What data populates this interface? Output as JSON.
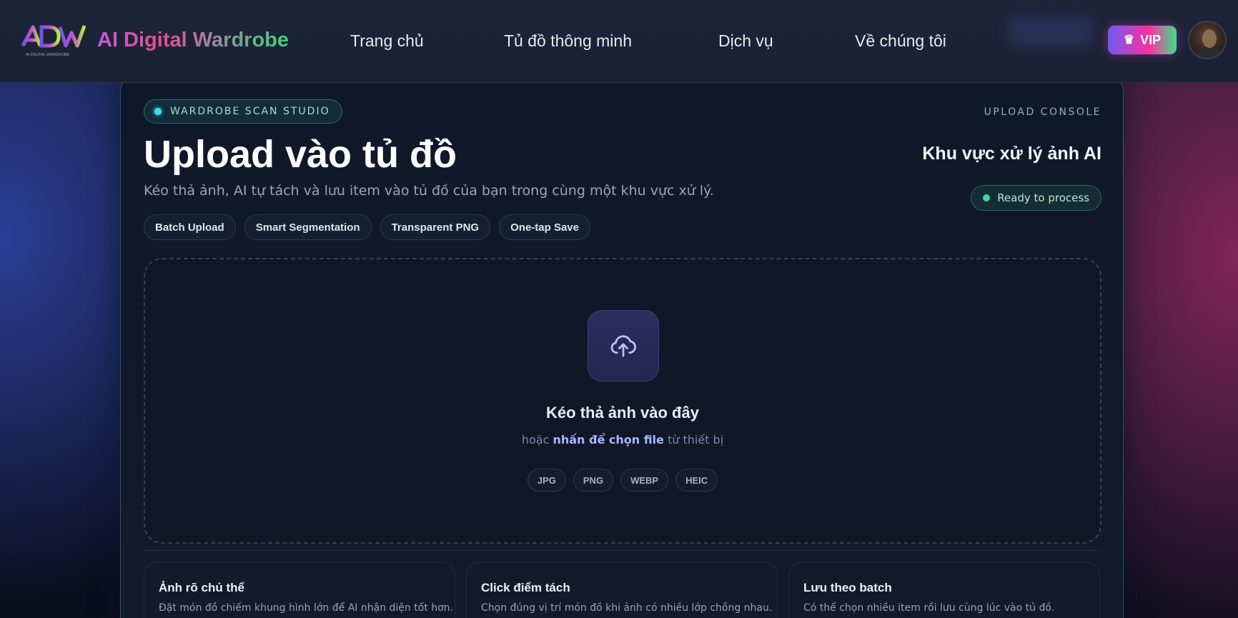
{
  "header": {
    "brand": "AI Digital Wardrobe",
    "logo_text": "ADW",
    "logo_subtext": "AI DIGITAL WARDROBE",
    "nav": [
      "Trang chủ",
      "Tủ đồ thông minh",
      "Dịch vụ",
      "Về chúng tôi"
    ],
    "vip_label": "VIP",
    "vip_icon": "crown-icon",
    "accent_gradient": [
      "#6a5cf2",
      "#ff2fa0",
      "#3fe08a"
    ]
  },
  "card": {
    "badge": "WARDROBE SCAN STUDIO",
    "console_label": "UPLOAD CONSOLE",
    "title": "Upload vào tủ đồ",
    "panel_title": "Khu vực xử lý ảnh AI",
    "subtitle": "Kéo thả ảnh, AI tự tách và lưu item vào tủ đồ của bạn trong cùng một khu vực xử lý.",
    "status": "Ready to process",
    "status_color": "#3fd99a",
    "features": [
      "Batch Upload",
      "Smart Segmentation",
      "Transparent PNG",
      "One-tap Save"
    ]
  },
  "dropzone": {
    "icon": "cloud-upload-icon",
    "title": "Kéo thả ảnh vào đây",
    "sub_prefix": "hoặc",
    "sub_link": "nhấn để chọn file",
    "sub_suffix": "từ thiết bị",
    "formats": [
      "JPG",
      "PNG",
      "WEBP",
      "HEIC"
    ]
  },
  "tips": [
    {
      "title": "Ảnh rõ chủ thể",
      "text": "Đặt món đồ chiếm khung hình lớn để AI nhận diện tốt hơn."
    },
    {
      "title": "Click điểm tách",
      "text": "Chọn đúng vị trí món đồ khi ảnh có nhiều lớp chồng nhau."
    },
    {
      "title": "Lưu theo batch",
      "text": "Có thể chọn nhiều item rồi lưu cùng lúc vào tủ đồ."
    }
  ]
}
